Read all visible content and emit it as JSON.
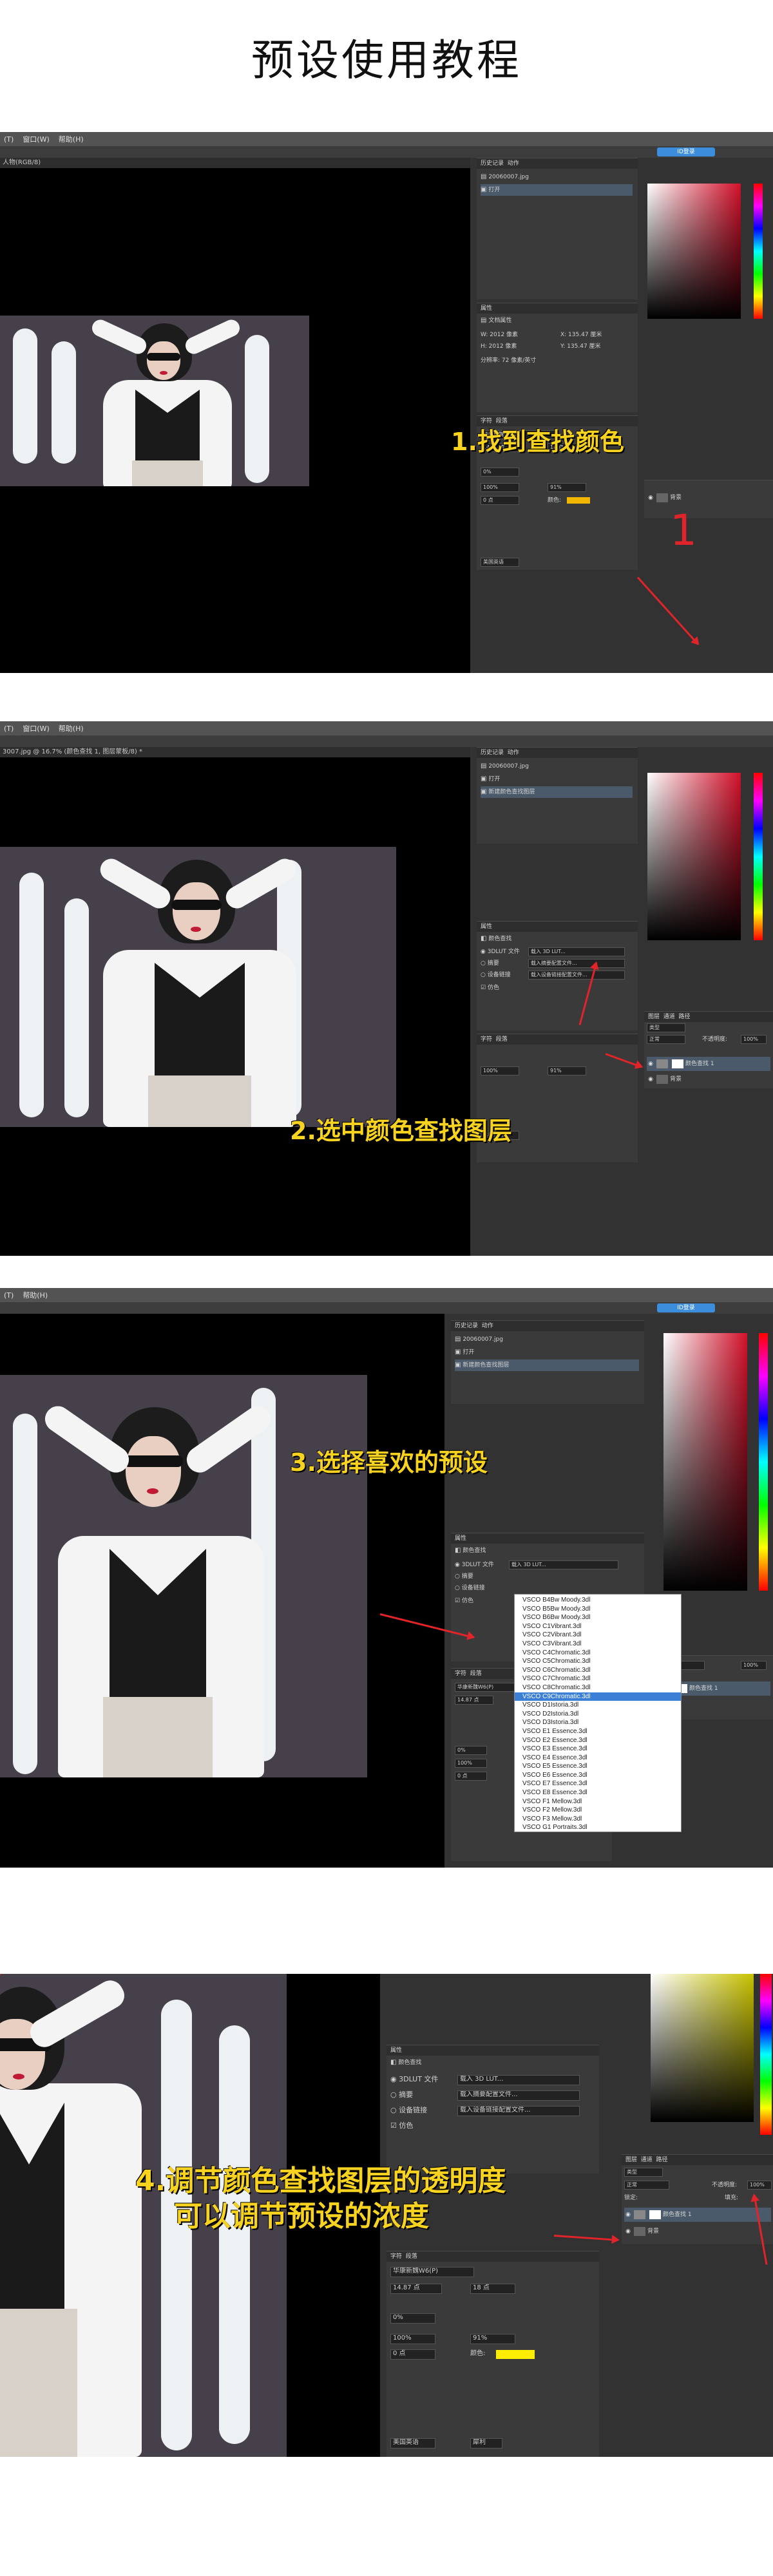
{
  "title": "预设使用教程",
  "ps": {
    "menu": [
      "(T)",
      "窗口(W)",
      "帮助(H)"
    ],
    "cloud_badge": "ID登录",
    "panel1_tab": "人物(RGB/8)",
    "panel2_tab": "3007.jpg @ 16.7% (颜色查找 1, 图层蒙板/8) *",
    "history_label": "历史记录",
    "history_tab2": "动作",
    "history_file": "20060007.jpg",
    "history_open": "打开",
    "history_new_layer": "新建颜色查找图层",
    "properties_label": "属性",
    "doc_props_label": "文档属性",
    "doc_w": "W: 2012 像素",
    "doc_h": "H: 2012 像素",
    "doc_x": "X: 135.47 厘米",
    "doc_y": "Y: 135.47 厘米",
    "doc_res": "分辨率: 72 像素/英寸",
    "color_lookup_label": "颜色查找",
    "lut_3d": "3DLUT 文件",
    "lut_abstract": "摘要",
    "lut_device": "设备链接",
    "dither": "仿色",
    "lut_load": "载入 3D LUT...",
    "abstract_load": "载入摘要配置文件...",
    "device_load": "载入设备链接配置文件...",
    "char_label": "字符",
    "para_label": "段落",
    "font_name": "华康新魏W6(P)",
    "font_size": "14.87 点",
    "leading": "18 点",
    "tracking_pct": "0%",
    "scale_v": "100%",
    "scale_h": "91%",
    "baseline": "0 点",
    "color_label": "颜色:",
    "lang": "美国英语",
    "aa": "犀利",
    "layers_label": "图层",
    "channels_label": "通道",
    "paths_label": "路径",
    "kind": "类型",
    "blend": "正常",
    "opacity_label": "不透明度:",
    "opacity_val": "100%",
    "lock_label": "锁定:",
    "fill_label": "填充:",
    "fill_val": "100%",
    "layer_lookup": "颜色查找 1",
    "layer_bg": "背景",
    "color_label2": "颜色"
  },
  "captions": {
    "step1": "1.找到查找颜色",
    "step1_num": "1",
    "step2": "2.选中颜色查找图层",
    "step3": "3.选择喜欢的预设",
    "step4_line1": "4.调节颜色查找图层的透明度",
    "step4_line2": "可以调节预设的浓度"
  },
  "presets": [
    "VSCO B4Bw Moody.3dl",
    "VSCO B5Bw Moody.3dl",
    "VSCO B6Bw Moody.3dl",
    "VSCO C1Vibrant.3dl",
    "VSCO C2Vibrant.3dl",
    "VSCO C3Vibrant.3dl",
    "VSCO C4Chromatic.3dl",
    "VSCO C5Chromatic.3dl",
    "VSCO C6Chromatic.3dl",
    "VSCO C7Chromatic.3dl",
    "VSCO C8Chromatic.3dl",
    "VSCO C9Chromatic.3dl",
    "VSCO D1Istoria.3dl",
    "VSCO D2Istoria.3dl",
    "VSCO D3Istoria.3dl",
    "VSCO E1 Essence.3dl",
    "VSCO E2 Essence.3dl",
    "VSCO E3 Essence.3dl",
    "VSCO E4 Essence.3dl",
    "VSCO E5 Essence.3dl",
    "VSCO E6 Essence.3dl",
    "VSCO E7 Essence.3dl",
    "VSCO E8 Essence.3dl",
    "VSCO F1 Mellow.3dl",
    "VSCO F2 Mellow.3dl",
    "VSCO F3 Mellow.3dl",
    "VSCO G1 Portraits.3dl"
  ],
  "presets_selected_index": 11,
  "colors": {
    "caption": "#f7d21e",
    "arrow": "#e0242a",
    "selection": "#3b7fd7",
    "text_swatch": "#ffee00"
  }
}
